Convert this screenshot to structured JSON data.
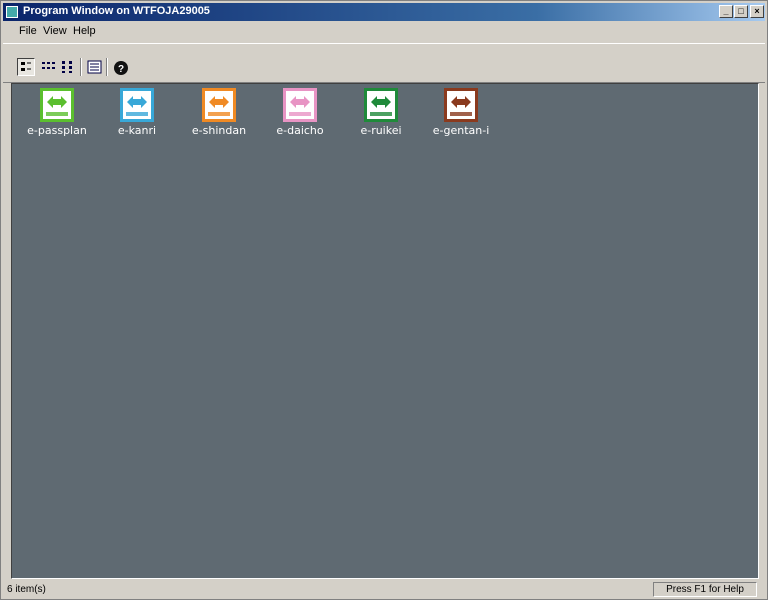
{
  "window": {
    "title": "Program Window on WTFOJA29005"
  },
  "menu": [
    "File",
    "View",
    "Help"
  ],
  "toolbar": {
    "buttons": [
      {
        "name": "large-icons-view-icon",
        "active": true
      },
      {
        "name": "small-icons-view-icon"
      },
      {
        "name": "list-view-icon"
      },
      {
        "name": "details-view-icon"
      },
      {
        "name": "help-icon"
      }
    ]
  },
  "apps": [
    {
      "label": "e-passplan",
      "color": "#5bbf2f",
      "arrow": "#2f8f10"
    },
    {
      "label": "e-kanri",
      "color": "#38a8d8",
      "arrow": "#1f7fb0"
    },
    {
      "label": "e-shindan",
      "color": "#f08a24",
      "arrow": "#e06a10"
    },
    {
      "label": "e-daicho",
      "color": "#e894c4",
      "arrow": "#d066a8"
    },
    {
      "label": "e-ruikei",
      "color": "#1f8a3a",
      "arrow": "#0f6a26"
    },
    {
      "label": "e-gentan-i",
      "color": "#8a3a1e",
      "arrow": "#6a2a10"
    }
  ],
  "status": {
    "left": "6 item(s)",
    "right": "Press F1 for Help"
  }
}
